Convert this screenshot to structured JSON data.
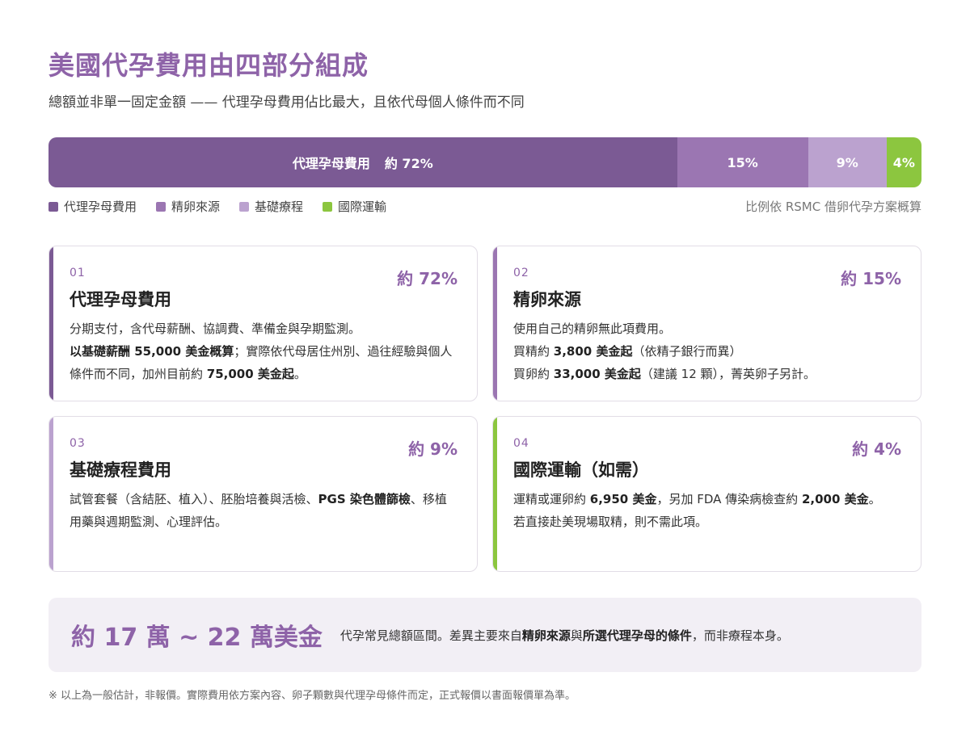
{
  "header": {
    "title": "美國代孕費用由四部分組成",
    "subtitle": "總額並非單一固定金額 —— 代理孕母費用佔比最大，且依代母個人條件而不同"
  },
  "chart_data": {
    "type": "bar",
    "orientation": "horizontal-stacked",
    "unit": "%",
    "categories": [
      "代理孕母費用",
      "精卵來源",
      "基礎療程",
      "國際運輸"
    ],
    "values": [
      72,
      15,
      9,
      4
    ],
    "segment_labels": [
      "約 72%",
      "15%",
      "9%",
      "4%"
    ],
    "colors": [
      "#7b5a94",
      "#9b76b2",
      "#bba2cf",
      "#8cc63f"
    ],
    "legend": [
      "代理孕母費用",
      "精卵來源",
      "基礎療程",
      "國際運輸"
    ],
    "legend_position": "bottom-left",
    "note": "比例依 RSMC 借卵代孕方案概算"
  },
  "cards": [
    {
      "num": "01",
      "title": "代理孕母費用",
      "pct": "約 72%",
      "accent": "#7b5a94",
      "lines": [
        [
          {
            "t": "分期支付，含代母薪酬、協調費、準備金與孕期監測。"
          }
        ],
        [
          {
            "t": "以基礎薪酬 55,000 美金概算",
            "b": true
          },
          {
            "t": "；實際依代母居住州別、過往經驗與個人條件而不同，加州目前約 "
          },
          {
            "t": "75,000 美金起",
            "b": true
          },
          {
            "t": "。"
          }
        ]
      ]
    },
    {
      "num": "02",
      "title": "精卵來源",
      "pct": "約 15%",
      "accent": "#9b76b2",
      "lines": [
        [
          {
            "t": "使用自己的精卵無此項費用。"
          }
        ],
        [
          {
            "t": "買精約 "
          },
          {
            "t": "3,800 美金起",
            "b": true
          },
          {
            "t": "（依精子銀行而異）"
          }
        ],
        [
          {
            "t": "買卵約 "
          },
          {
            "t": "33,000 美金起",
            "b": true
          },
          {
            "t": "（建議 12 顆），菁英卵子另計。"
          }
        ]
      ]
    },
    {
      "num": "03",
      "title": "基礎療程費用",
      "pct": "約 9%",
      "accent": "#bba2cf",
      "lines": [
        [
          {
            "t": "試管套餐（含結胚、植入）、胚胎培養與活檢、"
          },
          {
            "t": "PGS 染色體篩檢",
            "b": true
          },
          {
            "t": "、移植用藥與週期監測、心理評估。"
          }
        ]
      ]
    },
    {
      "num": "04",
      "title": "國際運輸（如需）",
      "pct": "約 4%",
      "accent": "#8cc63f",
      "lines": [
        [
          {
            "t": "運精或運卵約 "
          },
          {
            "t": "6,950 美金",
            "b": true
          },
          {
            "t": "，另加 FDA 傳染病檢查約 "
          },
          {
            "t": "2,000 美金",
            "b": true
          },
          {
            "t": "。"
          }
        ],
        [
          {
            "t": "若直接赴美現場取精，則不需此項。"
          }
        ]
      ]
    }
  ],
  "summary": {
    "range": "約 17 萬 ~ 22 萬美金",
    "parts": [
      {
        "t": "代孕常見總額區間。差異主要來自"
      },
      {
        "t": "精卵來源",
        "b": true
      },
      {
        "t": "與"
      },
      {
        "t": "所選代理孕母的條件",
        "b": true
      },
      {
        "t": "，而非療程本身。"
      }
    ]
  },
  "footnote": "※ 以上為一般估計，非報價。實際費用依方案內容、卵子顆數與代理孕母條件而定，正式報價以書面報價單為準。"
}
